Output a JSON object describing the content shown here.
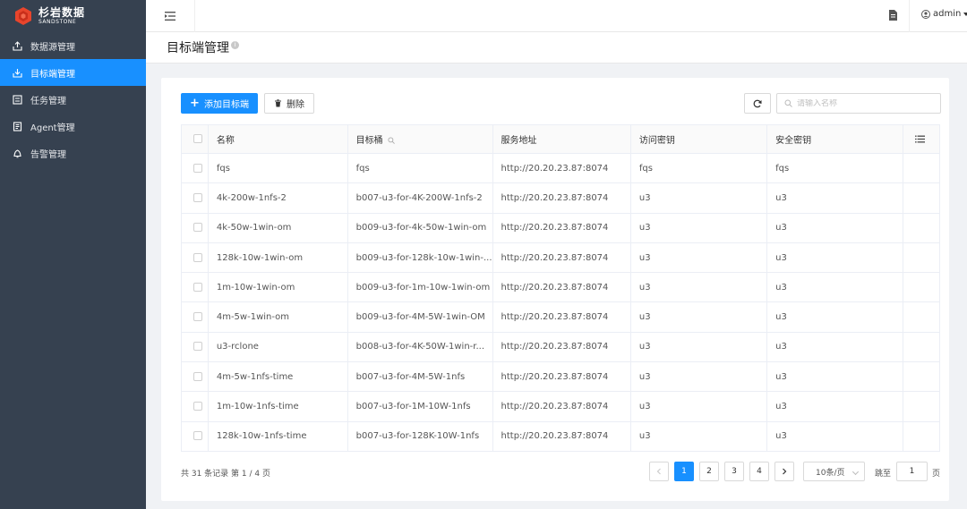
{
  "brand": {
    "name_cn": "杉岩数据",
    "name_en": "SANDSTONE"
  },
  "sidebar": {
    "items": [
      {
        "label": "数据源管理",
        "icon": "upload-tray-icon",
        "active": false
      },
      {
        "label": "目标端管理",
        "icon": "download-tray-icon",
        "active": true
      },
      {
        "label": "任务管理",
        "icon": "task-list-icon",
        "active": false
      },
      {
        "label": "Agent管理",
        "icon": "agent-document-icon",
        "active": false
      },
      {
        "label": "告警管理",
        "icon": "alarm-bell-icon",
        "active": false
      }
    ]
  },
  "header": {
    "user": "admin"
  },
  "page": {
    "title": "目标端管理"
  },
  "toolbar": {
    "add_label": "添加目标端",
    "delete_label": "删除",
    "search_placeholder": "请输入名称"
  },
  "table": {
    "columns": [
      "名称",
      "目标桶",
      "服务地址",
      "访问密钥",
      "安全密钥"
    ],
    "rows": [
      {
        "name": "fqs",
        "bucket": "fqs",
        "addr": "http://20.20.23.87:8074",
        "ak": "fqs",
        "sk": "fqs"
      },
      {
        "name": "4k-200w-1nfs-2",
        "bucket": "b007-u3-for-4K-200W-1nfs-2",
        "addr": "http://20.20.23.87:8074",
        "ak": "u3",
        "sk": "u3"
      },
      {
        "name": "4k-50w-1win-om",
        "bucket": "b009-u3-for-4k-50w-1win-om",
        "addr": "http://20.20.23.87:8074",
        "ak": "u3",
        "sk": "u3"
      },
      {
        "name": "128k-10w-1win-om",
        "bucket": "b009-u3-for-128k-10w-1win-...",
        "addr": "http://20.20.23.87:8074",
        "ak": "u3",
        "sk": "u3"
      },
      {
        "name": "1m-10w-1win-om",
        "bucket": "b009-u3-for-1m-10w-1win-om",
        "addr": "http://20.20.23.87:8074",
        "ak": "u3",
        "sk": "u3"
      },
      {
        "name": "4m-5w-1win-om",
        "bucket": "b009-u3-for-4M-5W-1win-OM",
        "addr": "http://20.20.23.87:8074",
        "ak": "u3",
        "sk": "u3"
      },
      {
        "name": "u3-rclone",
        "bucket": "b008-u3-for-4K-50W-1win-r...",
        "addr": "http://20.20.23.87:8074",
        "ak": "u3",
        "sk": "u3"
      },
      {
        "name": "4m-5w-1nfs-time",
        "bucket": "b007-u3-for-4M-5W-1nfs",
        "addr": "http://20.20.23.87:8074",
        "ak": "u3",
        "sk": "u3"
      },
      {
        "name": "1m-10w-1nfs-time",
        "bucket": "b007-u3-for-1M-10W-1nfs",
        "addr": "http://20.20.23.87:8074",
        "ak": "u3",
        "sk": "u3"
      },
      {
        "name": "128k-10w-1nfs-time",
        "bucket": "b007-u3-for-128K-10W-1nfs",
        "addr": "http://20.20.23.87:8074",
        "ak": "u3",
        "sk": "u3"
      }
    ]
  },
  "pagination": {
    "summary": "共 31 条记录 第 1 / 4 页",
    "pages": [
      "1",
      "2",
      "3",
      "4"
    ],
    "current": "1",
    "page_size": "10条/页",
    "jump_label": "跳至",
    "jump_value": "1",
    "jump_suffix": "页"
  },
  "colors": {
    "sidebar_bg": "#364150",
    "primary": "#1890ff"
  }
}
